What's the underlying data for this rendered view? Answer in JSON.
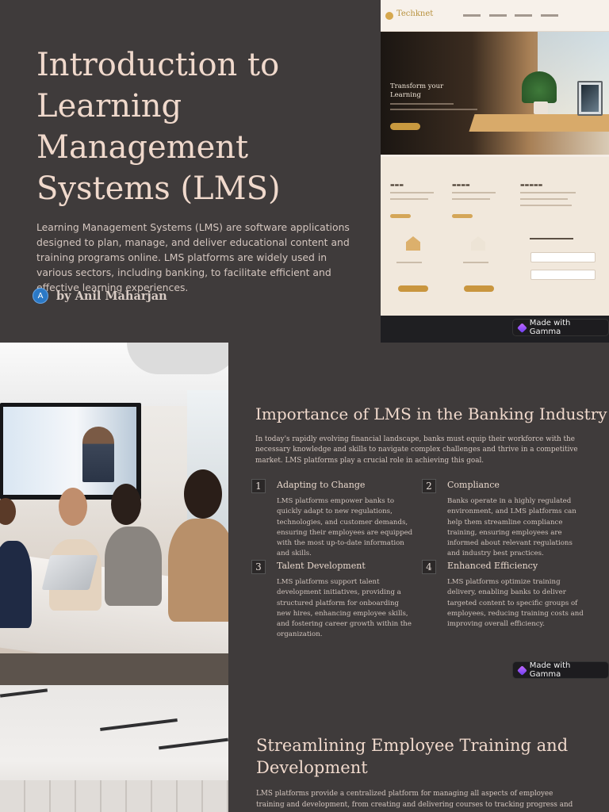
{
  "slide1": {
    "title": "Introduction to Learning Management Systems (LMS)",
    "description": "Learning Management Systems (LMS) are software applications designed to plan, manage, and deliver educational content and training programs online. LMS platforms are widely used in various sectors, including banking, to facilitate efficient and effective learning experiences.",
    "author_initial": "A",
    "author": "by Anil Maharjan",
    "mock_logo": "Techknet",
    "mock_hero_text": "Transform your Learning",
    "badge": "Made with Gamma"
  },
  "slide2": {
    "title": "Importance of LMS in the Banking Industry",
    "intro": "In today's rapidly evolving financial landscape, banks must equip their workforce with the necessary knowledge and skills to navigate complex challenges and thrive in a competitive market. LMS platforms play a crucial role in achieving this goal.",
    "items": [
      {
        "num": "1",
        "title": "Adapting to Change",
        "body": "LMS platforms empower banks to quickly adapt to new regulations, technologies, and customer demands, ensuring their employees are equipped with the most up-to-date information and skills."
      },
      {
        "num": "2",
        "title": "Compliance",
        "body": "Banks operate in a highly regulated environment, and LMS platforms can help them streamline compliance training, ensuring employees are informed about relevant regulations and industry best practices."
      },
      {
        "num": "3",
        "title": "Talent Development",
        "body": "LMS platforms support talent development initiatives, providing a structured platform for onboarding new hires, enhancing employee skills, and fostering career growth within the organization."
      },
      {
        "num": "4",
        "title": "Enhanced Efficiency",
        "body": "LMS platforms optimize training delivery, enabling banks to deliver targeted content to specific groups of employees, reducing training costs and improving overall efficiency."
      }
    ],
    "badge": "Made with Gamma"
  },
  "slide3": {
    "title": "Streamlining Employee Training and Development",
    "body": "LMS platforms provide a centralized platform for managing all aspects of employee training and development, from creating and delivering courses to tracking progress and"
  }
}
